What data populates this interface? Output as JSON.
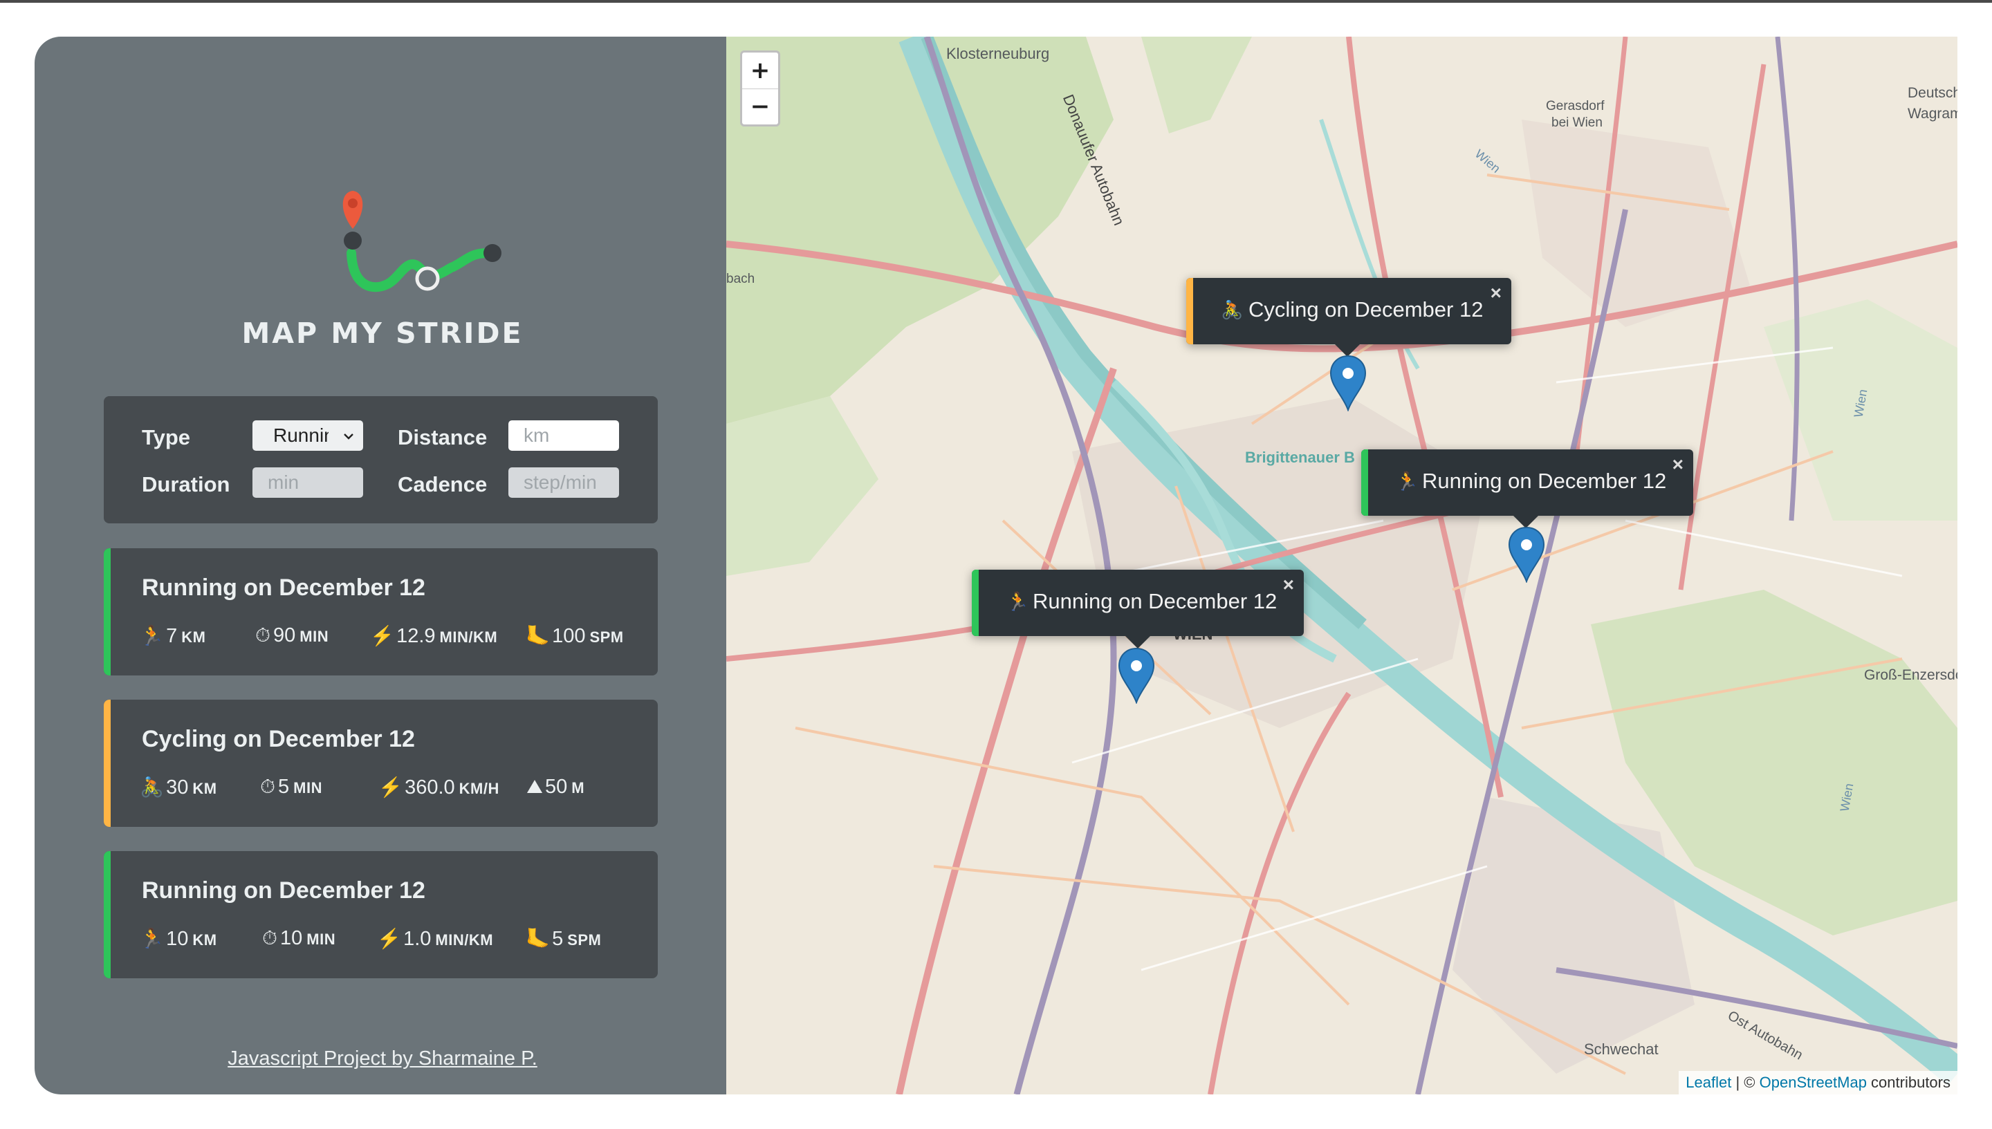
{
  "app": {
    "title": "MAP MY STRIDE"
  },
  "colors": {
    "running": "#2ec55a",
    "cycling": "#ffb545",
    "sidebar_bg": "#6b7479",
    "card_bg": "#464b4f"
  },
  "form": {
    "type_label": "Type",
    "type_value": "Running",
    "distance_label": "Distance",
    "distance_placeholder": "km",
    "duration_label": "Duration",
    "duration_placeholder": "min",
    "cadence_label": "Cadence",
    "cadence_placeholder": "step/min"
  },
  "workouts": [
    {
      "kind": "running",
      "title": "Running on December 12",
      "stats": [
        {
          "icon": "🏃",
          "value": "7",
          "unit": "KM"
        },
        {
          "icon": "⏱",
          "value": "90",
          "unit": "MIN"
        },
        {
          "icon": "⚡",
          "value": "12.9",
          "unit": "MIN/KM"
        },
        {
          "icon": "🦶",
          "value": "100",
          "unit": "SPM"
        }
      ]
    },
    {
      "kind": "cycling",
      "title": "Cycling on December 12",
      "stats": [
        {
          "icon": "🚴",
          "value": "30",
          "unit": "KM"
        },
        {
          "icon": "⏱",
          "value": "5",
          "unit": "MIN"
        },
        {
          "icon": "⚡",
          "value": "360.0",
          "unit": "KM/H"
        },
        {
          "icon": "⛰",
          "value": "50",
          "unit": "M"
        }
      ]
    },
    {
      "kind": "running",
      "title": "Running on December 12",
      "stats": [
        {
          "icon": "🏃",
          "value": "10",
          "unit": "KM"
        },
        {
          "icon": "⏱",
          "value": "10",
          "unit": "MIN"
        },
        {
          "icon": "⚡",
          "value": "1.0",
          "unit": "MIN/KM"
        },
        {
          "icon": "🦶",
          "value": "5",
          "unit": "SPM"
        }
      ]
    }
  ],
  "credit": "Javascript Project by Sharmaine P.",
  "map": {
    "zoom_in": "+",
    "zoom_out": "−",
    "places": {
      "klosterneuburg": "Klosterneuburg",
      "donauufer": "Donauufer Autobahn",
      "gerasdorf": "Gerasdorf",
      "gerasdorf2": "bei Wien",
      "deutsch": "Deutsch",
      "wagram": "Wagram",
      "bach": "bach",
      "brigittenau": "Brigittenauer B",
      "wien_center": "WIEN",
      "gross": "Groß-Enzersdorf",
      "schwechat": "Schwechat",
      "ostautobahn": "Ost Autobahn",
      "wien_river1": "Wien",
      "wien_river2": "Wien",
      "wien_river3": "Wien"
    },
    "popups": [
      {
        "emoji": "🚴",
        "text": "Cycling on December 12",
        "close": "×",
        "kind": "cycling"
      },
      {
        "emoji": "🏃",
        "text": "Running on December 12",
        "close": "×",
        "kind": "running"
      },
      {
        "emoji": "🏃",
        "text": "Running on December 12",
        "close": "×",
        "kind": "running"
      }
    ],
    "attribution": {
      "leaflet": "Leaflet",
      "sep": " | © ",
      "osm": "OpenStreetMap",
      "rest": " contributors"
    }
  }
}
